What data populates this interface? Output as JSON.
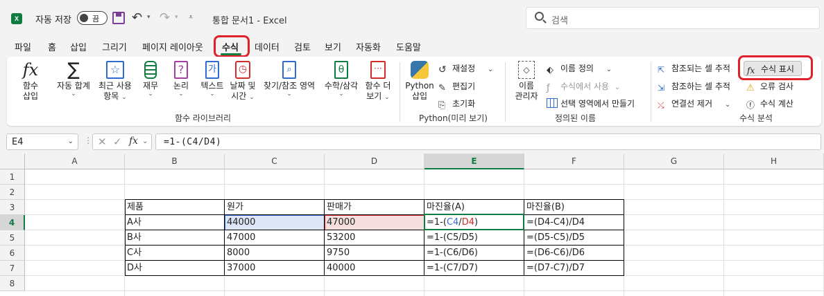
{
  "titlebar": {
    "app_icon": "excel-icon",
    "autosave_label": "자동 저장",
    "autosave_state": "끔",
    "document_title": "통합 문서1  -  Excel",
    "search_placeholder": "검색"
  },
  "tabs": [
    "파일",
    "홈",
    "삽입",
    "그리기",
    "페이지 레이아웃",
    "수식",
    "데이터",
    "검토",
    "보기",
    "자동화",
    "도움말"
  ],
  "active_tab": "수식",
  "ribbon": {
    "function_library": {
      "label": "함수 라이브러리",
      "insert_function": [
        "함수",
        "삽입"
      ],
      "autosum": [
        "자동 합계"
      ],
      "recent": [
        "최근 사용",
        "항목"
      ],
      "financial": [
        "재무"
      ],
      "logical": [
        "논리"
      ],
      "text": [
        "텍스트"
      ],
      "datetime": [
        "날짜 및",
        "시간"
      ],
      "lookup": [
        "찾기/참조 영역"
      ],
      "math": [
        "수학/삼각"
      ],
      "more": [
        "함수 더",
        "보기"
      ]
    },
    "python": {
      "label": "Python(미리 보기)",
      "insert_python": [
        "Python",
        "삽입"
      ],
      "reset_runtime": "재설정",
      "editor": "편집기",
      "initialize": "초기화"
    },
    "defined_names": {
      "label": "정의된 이름",
      "name_manager": [
        "이름",
        "관리자"
      ],
      "define_name": "이름 정의",
      "use_in_formula": "수식에서 사용",
      "create_from_selection": "선택 영역에서 만들기"
    },
    "formula_auditing": {
      "label": "수식 분석",
      "trace_precedents": "참조되는 셀 추적",
      "trace_dependents": "참조하는 셀 추적",
      "remove_arrows": "연결선 제거",
      "show_formulas": "수식 표시",
      "error_checking": "오류 검사",
      "evaluate_formula": "수식 계산"
    }
  },
  "formula_bar": {
    "name_box": "E4",
    "formula": "=1-(C4/D4)"
  },
  "columns": [
    "A",
    "B",
    "C",
    "D",
    "E",
    "F",
    "G",
    "H"
  ],
  "rows": [
    "1",
    "2",
    "3",
    "4",
    "5",
    "6",
    "7",
    "8"
  ],
  "selected_cell": "E4",
  "table": {
    "headers": [
      "제품",
      "원가",
      "판매가",
      "마진율(A)",
      "마진율(B)"
    ],
    "rows": [
      [
        "A사",
        "44000",
        "47000",
        "=1-(C4/D4)",
        "=(D4-C4)/D4"
      ],
      [
        "B사",
        "47000",
        "53200",
        "=1-(C5/D5)",
        "=(D5-C5)/D5"
      ],
      [
        "C사",
        "8000",
        "9750",
        "=1-(C6/D6)",
        "=(D6-C6)/D6"
      ],
      [
        "D사",
        "37000",
        "40000",
        "=1-(C7/D7)",
        "=(D7-C7)/D7"
      ]
    ],
    "editing_formula_parts": [
      "=1-(",
      "C4",
      "/",
      "D4",
      ")"
    ]
  },
  "colors": {
    "accent": "#107c41",
    "highlight_box": "#e0202a",
    "ref_blue": "#2e6bd1",
    "ref_red": "#d42a2a"
  }
}
